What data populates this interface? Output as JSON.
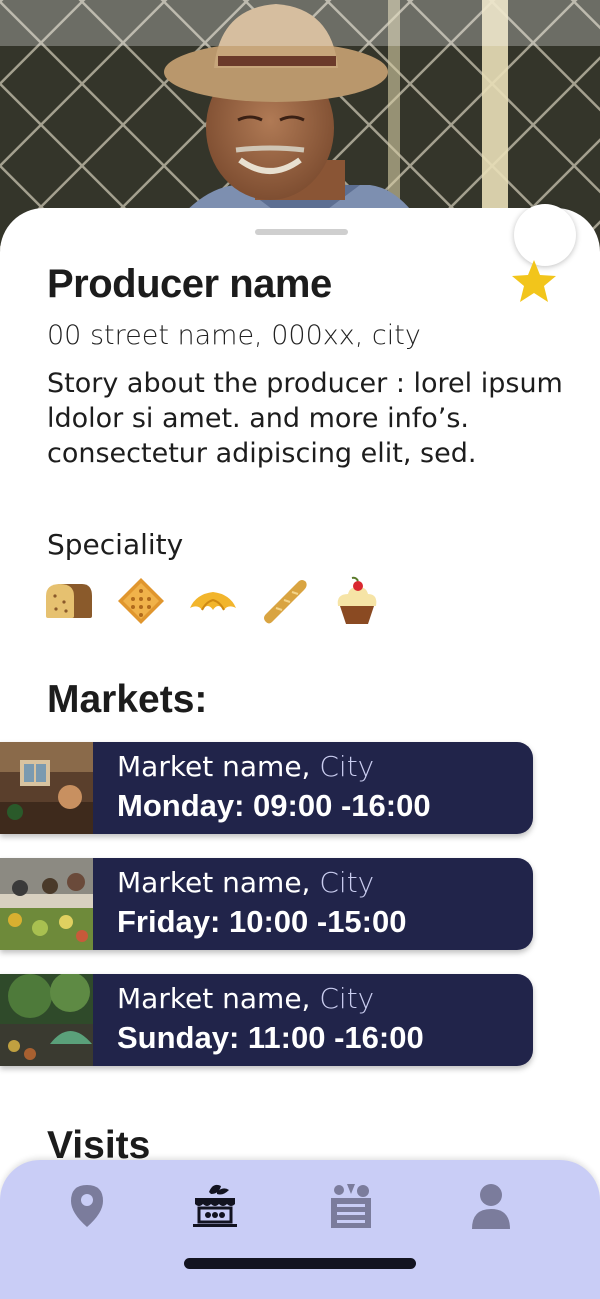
{
  "producer": {
    "name": "Producer name",
    "address": "00 street name, 000xx, city",
    "story": "Story about the producer : lorel ipsum ldolor si amet. and more info’s. consectetur adipiscing elit, sed.",
    "is_favorite": true
  },
  "speciality": {
    "label": "Speciality",
    "icons": [
      "bread-icon",
      "biscuit-icon",
      "croissant-icon",
      "baguette-icon",
      "cupcake-icon"
    ]
  },
  "markets": {
    "title": "Markets:",
    "items": [
      {
        "name": "Market name,",
        "city": "City",
        "schedule": "Monday: 09:00 -16:00"
      },
      {
        "name": "Market name,",
        "city": "City",
        "schedule": "Friday: 10:00 -15:00"
      },
      {
        "name": "Market name,",
        "city": "City",
        "schedule": "Sunday: 11:00 -16:00"
      }
    ]
  },
  "visits": {
    "title": "Visits"
  },
  "nav": {
    "items": [
      {
        "icon": "map-pin-icon",
        "active": false
      },
      {
        "icon": "market-stall-icon",
        "active": true
      },
      {
        "icon": "produce-crate-icon",
        "active": false
      },
      {
        "icon": "user-icon",
        "active": false
      }
    ]
  },
  "colors": {
    "card_background": "#21244a",
    "nav_background": "#c9cdf6",
    "nav_icon": "#7b7c9c",
    "nav_icon_active": "#121320",
    "star": "#f2c51b",
    "city_text": "#c9ccef"
  }
}
